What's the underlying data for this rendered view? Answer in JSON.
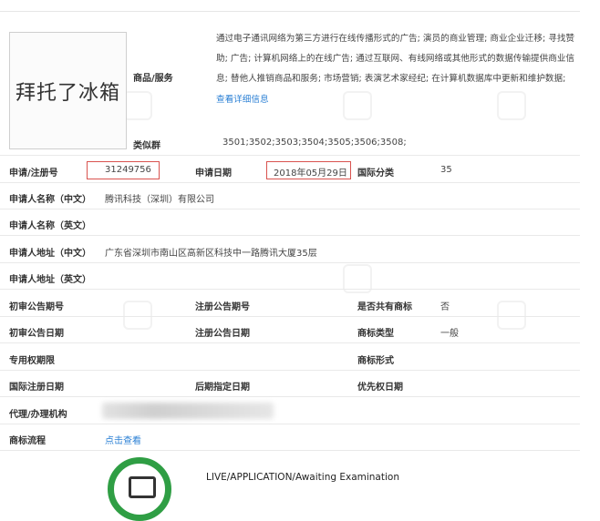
{
  "logo": {
    "text": "拜托了冰箱"
  },
  "labels": {
    "goods_services": "商品/服务",
    "similar_group": "类似群",
    "reg_no": "申请/注册号",
    "app_date": "申请日期",
    "intl_class": "国际分类",
    "applicant_cn": "申请人名称（中文）",
    "applicant_en": "申请人名称（英文）",
    "address_cn": "申请人地址（中文）",
    "address_en": "申请人地址（英文）",
    "prelim_pub_no": "初审公告期号",
    "reg_pub_no": "注册公告期号",
    "shared": "是否共有商标",
    "prelim_pub_date": "初审公告日期",
    "reg_pub_date": "注册公告日期",
    "mark_type": "商标类型",
    "exclusive_period": "专用权期限",
    "mark_form": "商标形式",
    "intl_reg_date": "国际注册日期",
    "later_date": "后期指定日期",
    "priority_date": "优先权日期",
    "agent": "代理/办理机构",
    "process": "商标流程"
  },
  "values": {
    "services_text": "通过电子通讯网络为第三方进行在线传播形式的广告; 演员的商业管理; 商业企业迁移; 寻找赞助; 广告; 计算机网络上的在线广告; 通过互联网、有线网络或其他形式的数据传输提供商业信息; 替他人推销商品和服务; 市场营销; 表演艺术家经纪; 在计算机数据库中更新和维护数据;",
    "services_more_link": "查看详细信息",
    "similar_group": "3501;3502;3503;3504;3505;3506;3508;",
    "reg_no": "31249756",
    "app_date": "2018年05月29日",
    "intl_class": "35",
    "applicant_cn": "腾讯科技（深圳）有限公司",
    "address_cn": "广东省深圳市南山区高新区科技中一路腾讯大厦35层",
    "shared": "否",
    "mark_type": "一般",
    "process_link": "点击查看",
    "status": "LIVE/APPLICATION/Awaiting Examination"
  },
  "colors": {
    "highlight_box": "#d9534f",
    "link": "#2a7fd4",
    "status_green": "#2f9e44"
  }
}
